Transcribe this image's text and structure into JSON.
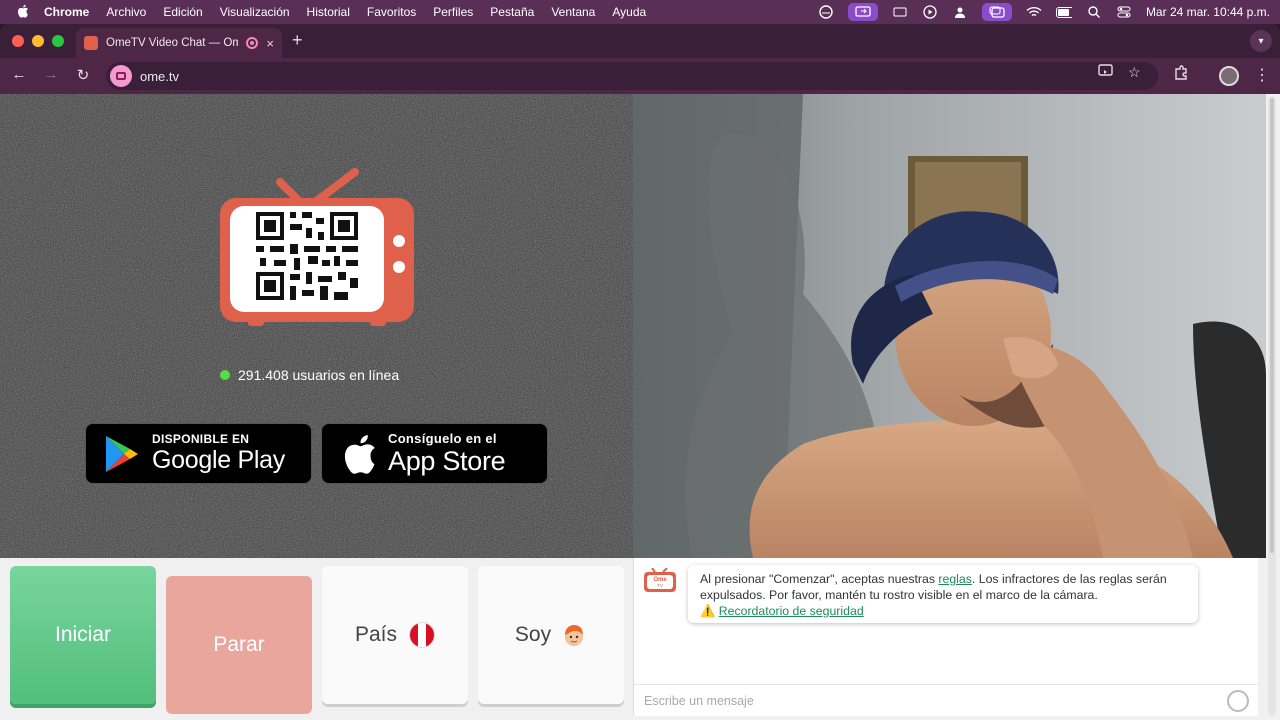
{
  "menubar": {
    "app": "Chrome",
    "items": [
      "Archivo",
      "Edición",
      "Visualización",
      "Historial",
      "Favoritos",
      "Perfiles",
      "Pestaña",
      "Ventana",
      "Ayuda"
    ],
    "clock": "Mar 24 mar.  10:44 p.m."
  },
  "browser": {
    "tab_title": "OmeTV Video Chat — Omegle",
    "tab_close": "×",
    "new_tab": "+",
    "url": "ome.tv",
    "nav_back": "←",
    "nav_forward": "→",
    "nav_reload": "↻",
    "bookmark_star": "☆"
  },
  "left_panel": {
    "online_text": "291.408 usuarios en línea",
    "google_play": {
      "small": "DISPONIBLE EN",
      "big": "Google Play"
    },
    "app_store": {
      "small": "Consíguelo en el",
      "big": "App Store"
    }
  },
  "controls": {
    "start": "Iniciar",
    "stop": "Parar",
    "country": "País",
    "gender": "Soy"
  },
  "chat": {
    "logo_text": "Ome",
    "logo_subtext": "TV",
    "notice_before_link": "Al presionar \"Comenzar\", aceptas nuestras ",
    "notice_link": "reglas",
    "notice_after_link": ". Los infractores de las reglas serán expulsados. Por favor, mantén tu rostro visible en el marco de la cámara.",
    "safety_link": "Recordatorio de seguridad",
    "input_placeholder": "Escribe un mensaje"
  },
  "colors": {
    "start": "#5ec686",
    "stop": "#e9a69d",
    "brand_red": "#e0614b",
    "link_green": "#1f8a5c"
  }
}
